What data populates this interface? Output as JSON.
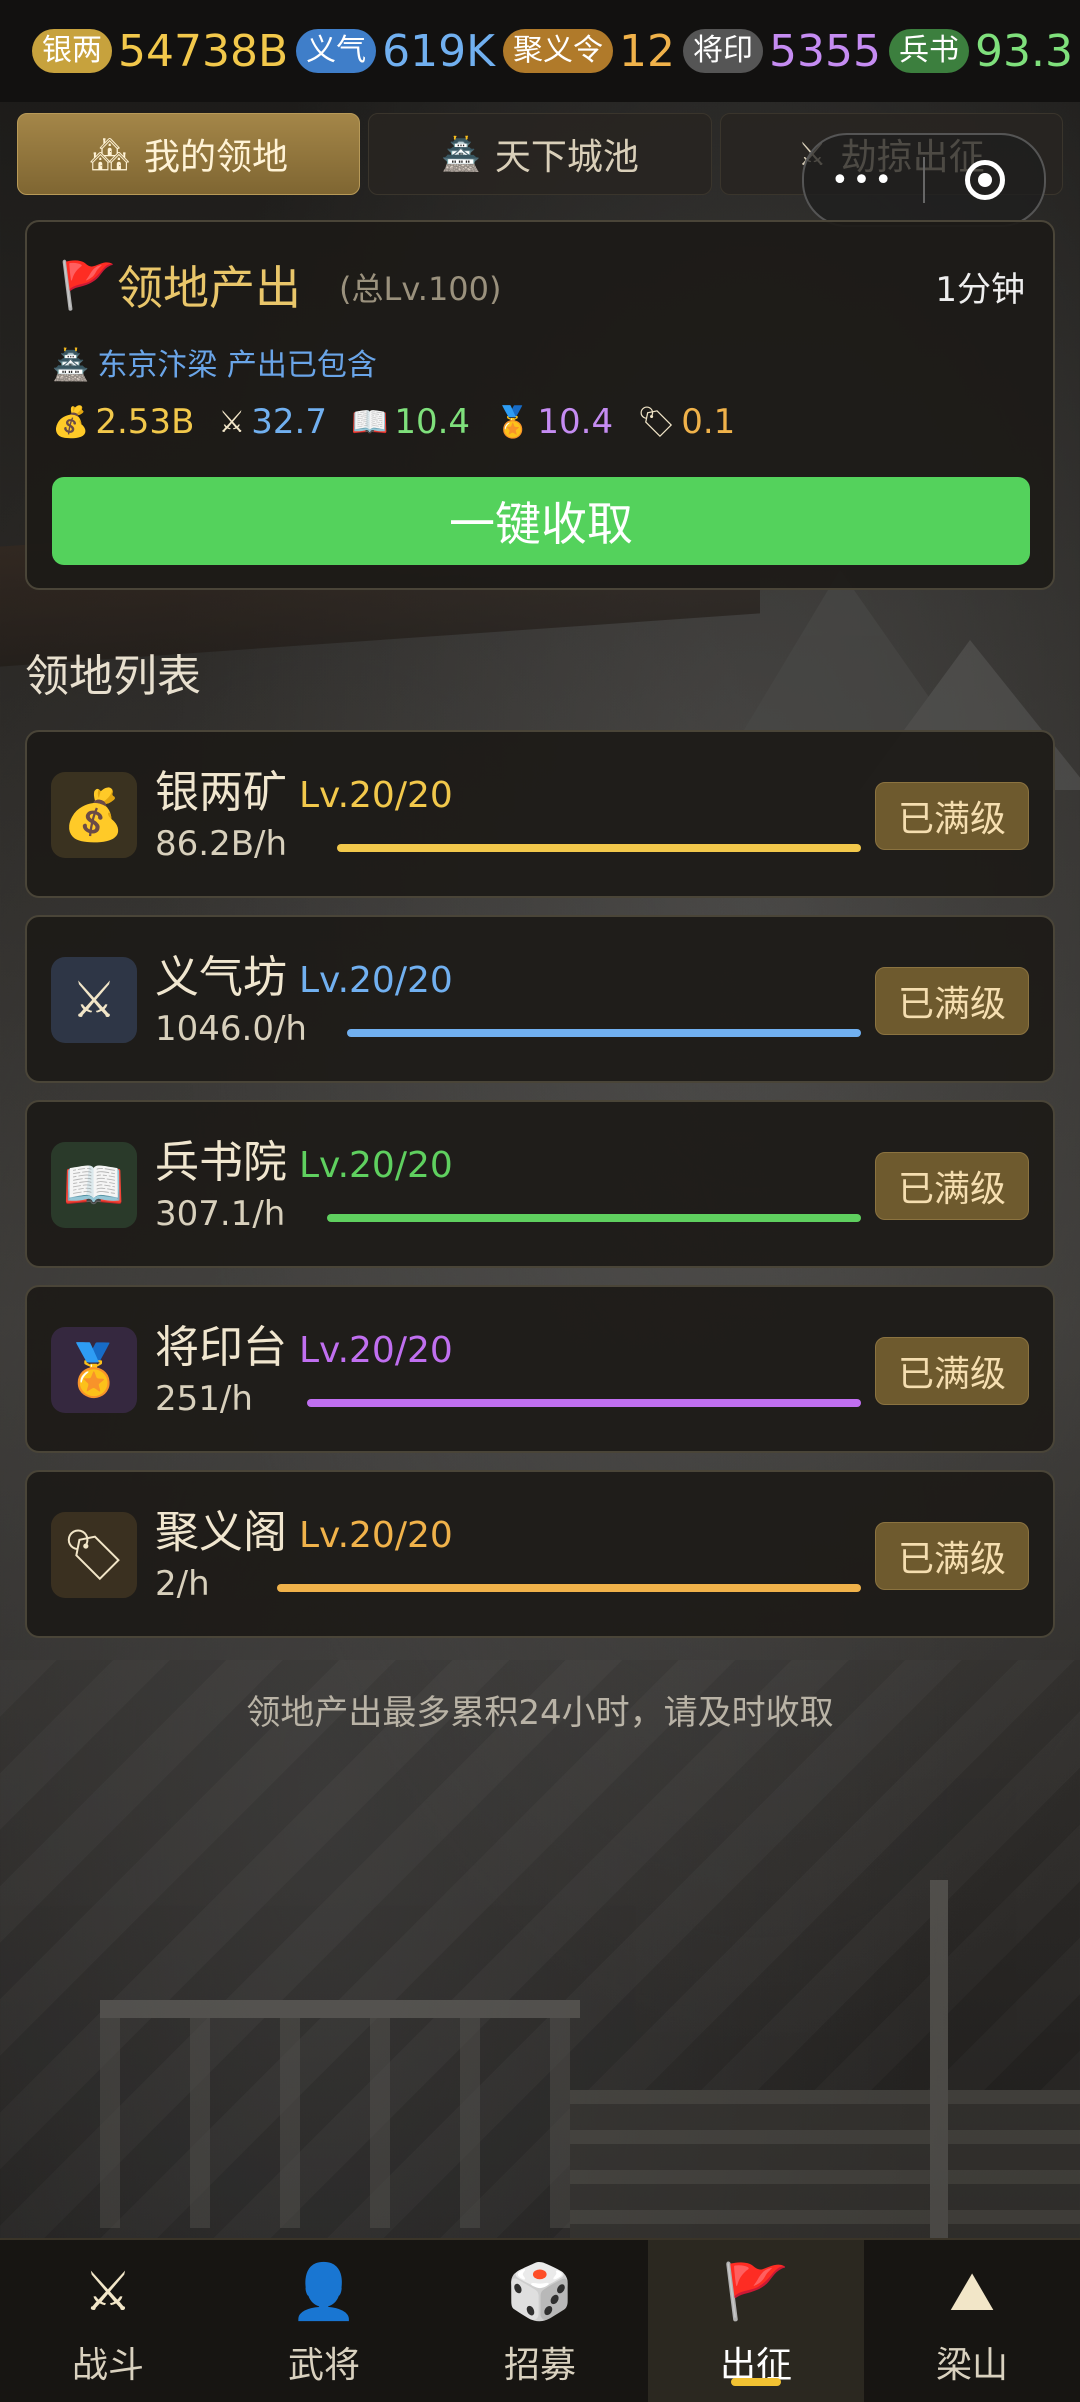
{
  "resources": [
    {
      "label": "银两",
      "value": "54738B",
      "tag_color": "#c7a23d",
      "value_color": "#f2c84b"
    },
    {
      "label": "义气",
      "value": "619K",
      "tag_color": "#3f7ec9",
      "value_color": "#71b0f0"
    },
    {
      "label": "聚义令",
      "value": "12",
      "tag_color": "#b07a2a",
      "value_color": "#f0b24a"
    },
    {
      "label": "将印",
      "value": "5355",
      "tag_color": "#555",
      "value_color": "#c58cf2"
    },
    {
      "label": "兵书",
      "value": "93.3",
      "tag_color": "#3c7f3e",
      "value_color": "#7fe07c"
    }
  ],
  "tabs": [
    {
      "label": "我的领地",
      "icon": "house-icon",
      "glyph": "🏘"
    },
    {
      "label": "天下城池",
      "icon": "pagoda-icon",
      "glyph": "🏯"
    },
    {
      "label": "劫掠出征",
      "icon": "crossed-swords-icon",
      "glyph": "⚔"
    }
  ],
  "capsule": {
    "dots": "•••"
  },
  "production": {
    "title": "领地产出",
    "subtitle": "(总Lv.100)",
    "timer": "1分钟",
    "city": "东京汴梁 产出已包含",
    "rates": [
      {
        "icon": "money-bag-icon",
        "glyph": "💰",
        "value": "2.53B",
        "color": "#f2c84b"
      },
      {
        "icon": "crossed-swords-icon",
        "glyph": "⚔",
        "value": "32.7",
        "color": "#71b0f0"
      },
      {
        "icon": "book-icon",
        "glyph": "📖",
        "value": "10.4",
        "color": "#7fe07c"
      },
      {
        "icon": "medal-icon",
        "glyph": "🏅",
        "value": "10.4",
        "color": "#c58cf2"
      },
      {
        "icon": "label-icon",
        "glyph": "🏷",
        "value": "0.1",
        "color": "#f0b24a"
      }
    ],
    "collect_label": "一键收取"
  },
  "list_title": "领地列表",
  "buildings": [
    {
      "name": "银两矿",
      "level": "Lv.20/20",
      "rate": "86.2B/h",
      "color": "#f2c84b",
      "icon": "money-bag-icon",
      "glyph": "💰",
      "icon_bg": "#3a3220",
      "status": "已满级",
      "bar_start": 310
    },
    {
      "name": "义气坊",
      "level": "Lv.20/20",
      "rate": "1046.0/h",
      "color": "#71b0f0",
      "icon": "crossed-swords-icon",
      "glyph": "⚔",
      "icon_bg": "#2e3646",
      "status": "已满级",
      "bar_start": 320
    },
    {
      "name": "兵书院",
      "level": "Lv.20/20",
      "rate": "307.1/h",
      "color": "#5fd05f",
      "icon": "book-icon",
      "glyph": "📖",
      "icon_bg": "#2a3a2a",
      "status": "已满级",
      "bar_start": 300
    },
    {
      "name": "将印台",
      "level": "Lv.20/20",
      "rate": "251/h",
      "color": "#c06ff0",
      "icon": "medal-icon",
      "glyph": "🏅",
      "icon_bg": "#35283f",
      "status": "已满级",
      "bar_start": 280
    },
    {
      "name": "聚义阁",
      "level": "Lv.20/20",
      "rate": "2/h",
      "color": "#f0b24a",
      "icon": "label-icon",
      "glyph": "🏷",
      "icon_bg": "#3a3020",
      "status": "已满级",
      "bar_start": 250
    }
  ],
  "note": "领地产出最多累积24小时，请及时收取",
  "nav": [
    {
      "label": "战斗",
      "icon": "crossed-swords-icon",
      "glyph": "⚔",
      "active": false
    },
    {
      "label": "武将",
      "icon": "person-icon",
      "glyph": "👤",
      "active": false
    },
    {
      "label": "招募",
      "icon": "dice-icon",
      "glyph": "🎲",
      "active": false
    },
    {
      "label": "出征",
      "icon": "flag-icon",
      "glyph": "🚩",
      "active": true
    },
    {
      "label": "梁山",
      "icon": "mountain-icon",
      "glyph": "⛰",
      "active": false
    }
  ]
}
